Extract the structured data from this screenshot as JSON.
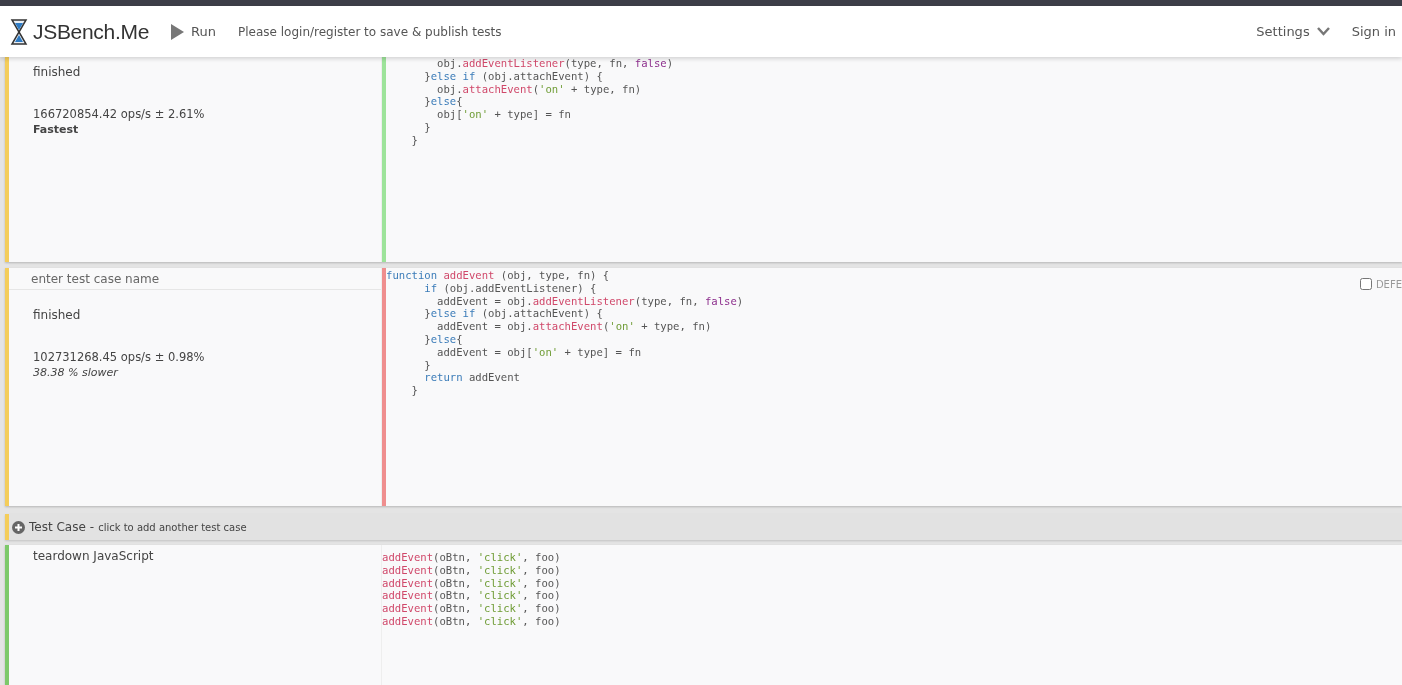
{
  "header": {
    "logo": "JSBench.Me",
    "run": "Run",
    "message": "Please login/register to save & publish tests",
    "settings": "Settings",
    "sign_in": "Sign in"
  },
  "cases": [
    {
      "status": "finished",
      "result": "166720854.42 ops/s ± 2.61%",
      "verdict": {
        "kind": "fastest",
        "text": "Fastest"
      },
      "color": "#9de39a",
      "code": [
        [
          {
            "kind": "plain",
            "text": "        obj."
          },
          {
            "kind": "function",
            "text": "addEventListener"
          },
          {
            "kind": "plain",
            "text": "(type, fn, "
          },
          {
            "kind": "literal",
            "text": "false"
          },
          {
            "kind": "plain",
            "text": ")"
          }
        ],
        [
          {
            "kind": "plain",
            "text": "      }"
          },
          {
            "kind": "keyword",
            "text": "else if"
          },
          {
            "kind": "plain",
            "text": " (obj.attachEvent) {"
          }
        ],
        [
          {
            "kind": "plain",
            "text": "        obj."
          },
          {
            "kind": "function",
            "text": "attachEvent"
          },
          {
            "kind": "plain",
            "text": "("
          },
          {
            "kind": "string",
            "text": "'on'"
          },
          {
            "kind": "plain",
            "text": " + type, fn)"
          }
        ],
        [
          {
            "kind": "plain",
            "text": "      }"
          },
          {
            "kind": "keyword",
            "text": "else"
          },
          {
            "kind": "plain",
            "text": "{"
          }
        ],
        [
          {
            "kind": "plain",
            "text": "        obj["
          },
          {
            "kind": "string",
            "text": "'on'"
          },
          {
            "kind": "plain",
            "text": " + type] = fn"
          }
        ],
        [
          {
            "kind": "plain",
            "text": "      }"
          }
        ],
        [
          {
            "kind": "plain",
            "text": "    }"
          }
        ]
      ]
    },
    {
      "name_placeholder": "enter test case name",
      "status": "finished",
      "result": "102731268.45 ops/s ± 0.98%",
      "verdict": {
        "kind": "slower",
        "text": "38.38 % slower"
      },
      "color": "#ef8e8e",
      "defer": {
        "label": "DEFE",
        "checked": false
      },
      "code": [
        [
          {
            "kind": "keyword",
            "text": "function "
          },
          {
            "kind": "function",
            "text": "addEvent"
          },
          {
            "kind": "plain",
            "text": " (obj, type, fn) {"
          }
        ],
        [
          {
            "kind": "keyword",
            "text": "      if"
          },
          {
            "kind": "plain",
            "text": " (obj.addEventListener) {"
          }
        ],
        [
          {
            "kind": "plain",
            "text": "        addEvent = obj."
          },
          {
            "kind": "function",
            "text": "addEventListener"
          },
          {
            "kind": "plain",
            "text": "(type, fn, "
          },
          {
            "kind": "literal",
            "text": "false"
          },
          {
            "kind": "plain",
            "text": ")"
          }
        ],
        [
          {
            "kind": "plain",
            "text": "      }"
          },
          {
            "kind": "keyword",
            "text": "else if"
          },
          {
            "kind": "plain",
            "text": " (obj.attachEvent) {"
          }
        ],
        [
          {
            "kind": "plain",
            "text": "        addEvent = obj."
          },
          {
            "kind": "function",
            "text": "attachEvent"
          },
          {
            "kind": "plain",
            "text": "("
          },
          {
            "kind": "string",
            "text": "'on'"
          },
          {
            "kind": "plain",
            "text": " + type, fn)"
          }
        ],
        [
          {
            "kind": "plain",
            "text": "      }"
          },
          {
            "kind": "keyword",
            "text": "else"
          },
          {
            "kind": "plain",
            "text": "{"
          }
        ],
        [
          {
            "kind": "plain",
            "text": "        addEvent = obj["
          },
          {
            "kind": "string",
            "text": "'on'"
          },
          {
            "kind": "plain",
            "text": " + type] = fn"
          }
        ],
        [
          {
            "kind": "plain",
            "text": "      }"
          }
        ],
        [
          {
            "kind": "keyword",
            "text": "      return"
          },
          {
            "kind": "plain",
            "text": " addEvent"
          }
        ],
        [
          {
            "kind": "plain",
            "text": "    }"
          }
        ]
      ]
    }
  ],
  "add_case": {
    "title": "Test Case",
    "separator": "-",
    "hint": "click to add another test case"
  },
  "teardown": {
    "label": "teardown JavaScript",
    "code": [
      [
        {
          "kind": "function",
          "text": "addEvent"
        },
        {
          "kind": "plain",
          "text": "(oBtn, "
        },
        {
          "kind": "string",
          "text": "'click'"
        },
        {
          "kind": "plain",
          "text": ", foo)"
        }
      ],
      [
        {
          "kind": "function",
          "text": "addEvent"
        },
        {
          "kind": "plain",
          "text": "(oBtn, "
        },
        {
          "kind": "string",
          "text": "'click'"
        },
        {
          "kind": "plain",
          "text": ", foo)"
        }
      ],
      [
        {
          "kind": "function",
          "text": "addEvent"
        },
        {
          "kind": "plain",
          "text": "(oBtn, "
        },
        {
          "kind": "string",
          "text": "'click'"
        },
        {
          "kind": "plain",
          "text": ", foo)"
        }
      ],
      [
        {
          "kind": "function",
          "text": "addEvent"
        },
        {
          "kind": "plain",
          "text": "(oBtn, "
        },
        {
          "kind": "string",
          "text": "'click'"
        },
        {
          "kind": "plain",
          "text": ", foo)"
        }
      ],
      [
        {
          "kind": "function",
          "text": "addEvent"
        },
        {
          "kind": "plain",
          "text": "(oBtn, "
        },
        {
          "kind": "string",
          "text": "'click'"
        },
        {
          "kind": "plain",
          "text": ", foo)"
        }
      ],
      [
        {
          "kind": "function",
          "text": "addEvent"
        },
        {
          "kind": "plain",
          "text": "(oBtn, "
        },
        {
          "kind": "string",
          "text": "'click'"
        },
        {
          "kind": "plain",
          "text": ", foo)"
        }
      ]
    ]
  }
}
